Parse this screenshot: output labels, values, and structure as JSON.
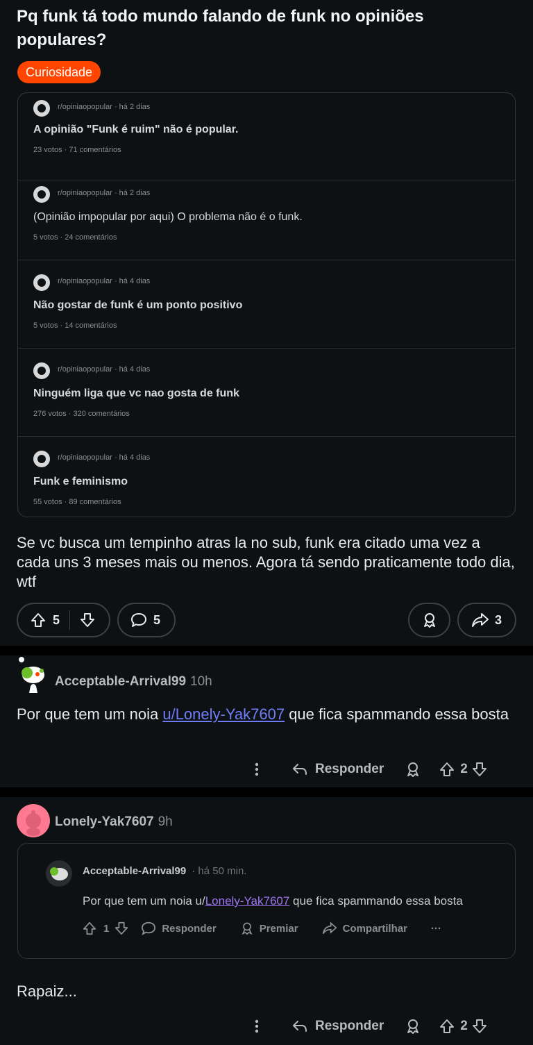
{
  "post": {
    "title": "Pq funk tá todo mundo falando de funk no opiniões populares?",
    "flair": "Curiosidade",
    "flair_color": "#ff4500",
    "embed_items": [
      {
        "meta": "r/opiniaopopular · há 2 dias",
        "title": "A opinião \"Funk é ruim\" não é popular.",
        "stats": "23 votos · 71 comentários"
      },
      {
        "meta": "r/opiniaopopular · há 2 dias",
        "title": "(Opinião impopular por aqui) O problema não é o funk.",
        "stats": "5 votos · 24 comentários"
      },
      {
        "meta": "r/opiniaopopular · há 4 dias",
        "title": "Não gostar de funk é um ponto positivo",
        "stats": "5 votos · 14 comentários"
      },
      {
        "meta": "r/opiniaopopular · há 4 dias",
        "title": "Ninguém liga que vc nao gosta de funk",
        "stats": "276 votos · 320 comentários"
      },
      {
        "meta": "r/opiniaopopular · há 4 dias",
        "title": "Funk e feminismo",
        "stats": "55 votos · 89 comentários"
      }
    ],
    "body": "Se vc busca um tempinho atras la no sub, funk era citado uma vez a cada uns 3 meses mais ou menos. Agora tá sendo praticamente todo dia, wtf",
    "votes": "5",
    "comments": "5",
    "shares": "3"
  },
  "comment1": {
    "user": "Acceptable-Arrival99",
    "time": "10h",
    "text_before": "Por que tem um noia ",
    "mention": "u/Lonely-Yak7607",
    "text_after": " que fica spammando essa bosta",
    "reply_label": "Responder",
    "votes": "2"
  },
  "comment2": {
    "user": "Lonely-Yak7607",
    "time": "9h",
    "quote": {
      "user": "Acceptable-Arrival99",
      "time": "· há 50 min.",
      "text_before": "Por que tem um noia u/",
      "mention": "Lonely-Yak7607",
      "text_after": " que fica spammando essa bosta",
      "votes": "1",
      "reply": "Responder",
      "award": "Premiar",
      "share": "Compartilhar",
      "more": "···"
    },
    "text": "Rapaiz...",
    "reply_label": "Responder",
    "votes": "2"
  }
}
